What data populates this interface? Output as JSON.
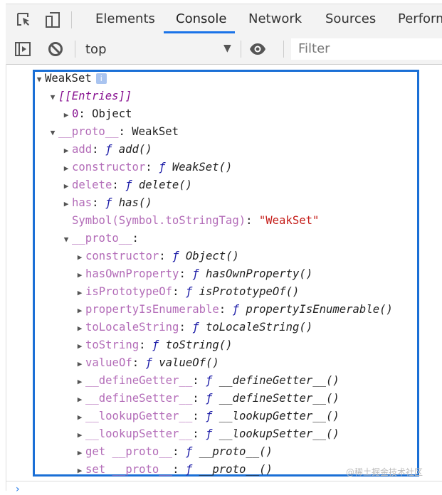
{
  "tabs": [
    {
      "label": "Elements"
    },
    {
      "label": "Console",
      "active": true
    },
    {
      "label": "Network"
    },
    {
      "label": "Sources"
    },
    {
      "label": "Perform"
    }
  ],
  "toolbar": {
    "context": "top",
    "filter_placeholder": "Filter"
  },
  "tree": [
    {
      "indent": 0,
      "arrow": "down",
      "key": "WeakSet",
      "kclass": "",
      "info": "i"
    },
    {
      "indent": 1,
      "arrow": "down",
      "key": "[[Entries]]",
      "kclass": "k-italic"
    },
    {
      "indent": 2,
      "arrow": "right",
      "key": "0",
      "kclass": "k-own",
      "sep": ": ",
      "plain": "Object"
    },
    {
      "indent": 1,
      "arrow": "down",
      "key": "__proto__",
      "kclass": "k-proto",
      "sep": ": ",
      "plain": "WeakSet"
    },
    {
      "indent": 2,
      "arrow": "right",
      "key": "add",
      "kclass": "k-proto",
      "sep": ": ",
      "f": "ƒ",
      "fn": "add()"
    },
    {
      "indent": 2,
      "arrow": "right",
      "key": "constructor",
      "kclass": "k-proto",
      "sep": ": ",
      "f": "ƒ",
      "fn": "WeakSet()"
    },
    {
      "indent": 2,
      "arrow": "right",
      "key": "delete",
      "kclass": "k-proto",
      "sep": ": ",
      "f": "ƒ",
      "fn": "delete()"
    },
    {
      "indent": 2,
      "arrow": "right",
      "key": "has",
      "kclass": "k-proto",
      "sep": ": ",
      "f": "ƒ",
      "fn": "has()"
    },
    {
      "indent": 2,
      "arrow": "none",
      "key": "Symbol(Symbol.toStringTag)",
      "kclass": "k-proto",
      "sep": ": ",
      "str": "\"WeakSet\""
    },
    {
      "indent": 2,
      "arrow": "down",
      "key": "__proto__",
      "kclass": "k-proto",
      "sep": ":"
    },
    {
      "indent": 3,
      "arrow": "right",
      "key": "constructor",
      "kclass": "k-proto",
      "sep": ": ",
      "f": "ƒ",
      "fn": "Object()"
    },
    {
      "indent": 3,
      "arrow": "right",
      "key": "hasOwnProperty",
      "kclass": "k-proto",
      "sep": ": ",
      "f": "ƒ",
      "fn": "hasOwnProperty()"
    },
    {
      "indent": 3,
      "arrow": "right",
      "key": "isPrototypeOf",
      "kclass": "k-proto",
      "sep": ": ",
      "f": "ƒ",
      "fn": "isPrototypeOf()"
    },
    {
      "indent": 3,
      "arrow": "right",
      "key": "propertyIsEnumerable",
      "kclass": "k-proto",
      "sep": ": ",
      "f": "ƒ",
      "fn": "propertyIsEnumerable()"
    },
    {
      "indent": 3,
      "arrow": "right",
      "key": "toLocaleString",
      "kclass": "k-proto",
      "sep": ": ",
      "f": "ƒ",
      "fn": "toLocaleString()"
    },
    {
      "indent": 3,
      "arrow": "right",
      "key": "toString",
      "kclass": "k-proto",
      "sep": ": ",
      "f": "ƒ",
      "fn": "toString()"
    },
    {
      "indent": 3,
      "arrow": "right",
      "key": "valueOf",
      "kclass": "k-proto",
      "sep": ": ",
      "f": "ƒ",
      "fn": "valueOf()"
    },
    {
      "indent": 3,
      "arrow": "right",
      "key": "__defineGetter__",
      "kclass": "k-proto",
      "sep": ": ",
      "f": "ƒ",
      "fn": "__defineGetter__()"
    },
    {
      "indent": 3,
      "arrow": "right",
      "key": "__defineSetter__",
      "kclass": "k-proto",
      "sep": ": ",
      "f": "ƒ",
      "fn": "__defineSetter__()"
    },
    {
      "indent": 3,
      "arrow": "right",
      "key": "__lookupGetter__",
      "kclass": "k-proto",
      "sep": ": ",
      "f": "ƒ",
      "fn": "__lookupGetter__()"
    },
    {
      "indent": 3,
      "arrow": "right",
      "key": "__lookupSetter__",
      "kclass": "k-proto",
      "sep": ": ",
      "f": "ƒ",
      "fn": "__lookupSetter__()"
    },
    {
      "indent": 3,
      "arrow": "right",
      "key": "get __proto__",
      "kclass": "k-proto",
      "sep": ": ",
      "f": "ƒ",
      "fn": "__proto__()"
    },
    {
      "indent": 3,
      "arrow": "right",
      "key": "set __proto__",
      "kclass": "k-proto",
      "sep": ": ",
      "f": "ƒ",
      "fn": "__proto__()"
    }
  ],
  "watermark": "@稀土掘金技术社区",
  "prompt": "›"
}
